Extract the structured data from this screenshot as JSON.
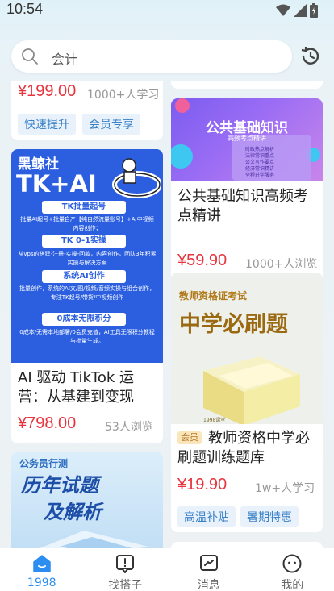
{
  "status": {
    "time": "10:54"
  },
  "search": {
    "placeholder": "会计"
  },
  "cards": {
    "c1": {
      "price": "¥199.00",
      "meta": "1000+人学习",
      "tags": [
        "快速提升",
        "会员专享"
      ]
    },
    "c2": {
      "title": "公共基础知识高频考点精讲",
      "price": "¥59.90",
      "meta": "1000+人浏览",
      "image": {
        "title": "公共基础知识",
        "subtitle": "高频考点精讲",
        "items": [
          "时政热点解析",
          "法律常识重点",
          "公文写作要点",
          "经济常识精讲",
          "全程升学服务"
        ]
      }
    },
    "c3": {
      "title": "AI 驱动 TikTok 运营：从基建到变现",
      "price": "¥798.00",
      "meta": "53人浏览",
      "image": {
        "brand": "黑鲸社",
        "headline": "TK+AI",
        "s1": "TK批量起号",
        "p1": "批量AI起号+批量自产【纯自然流量账号】+AI中视频内容创作；",
        "s2": "TK 0-1实操",
        "p2": "从vps的搭建-注册-实操-回款，内容创作，团队3年积累实操与解决方案",
        "s3": "系统AI创作",
        "p3": "批量创作，系统的AI文/图/视频/音频实操与组合创作，专注TK起号/带货/中视频创作",
        "s4": "0成本无限积分",
        "p4": "0成本/无需本地部署/0会员充值，AI工具无限积分教程与批量生成。"
      }
    },
    "c4": {
      "title": "教师资格中学必刷题训练题库",
      "badge": "会员",
      "price": "¥19.90",
      "meta": "1w+人学习",
      "tags": [
        "高温补贴",
        "暑期特惠"
      ],
      "image": {
        "label": "教师资格证考试",
        "headline": "中学必刷题",
        "book": "1998课堂"
      }
    },
    "c5": {
      "image": {
        "label": "公务员行测",
        "line1": "历年试题",
        "line2": "及解析"
      }
    }
  },
  "nav": {
    "items": [
      {
        "label": "1998",
        "icon": "home-icon",
        "active": true
      },
      {
        "label": "找搭子",
        "icon": "flag-card-icon"
      },
      {
        "label": "消息",
        "icon": "message-icon"
      },
      {
        "label": "我的",
        "icon": "profile-icon"
      }
    ]
  },
  "colors": {
    "accent": "#2b8ef0",
    "price": "#e8343d",
    "tag_text": "#3a82c8"
  }
}
